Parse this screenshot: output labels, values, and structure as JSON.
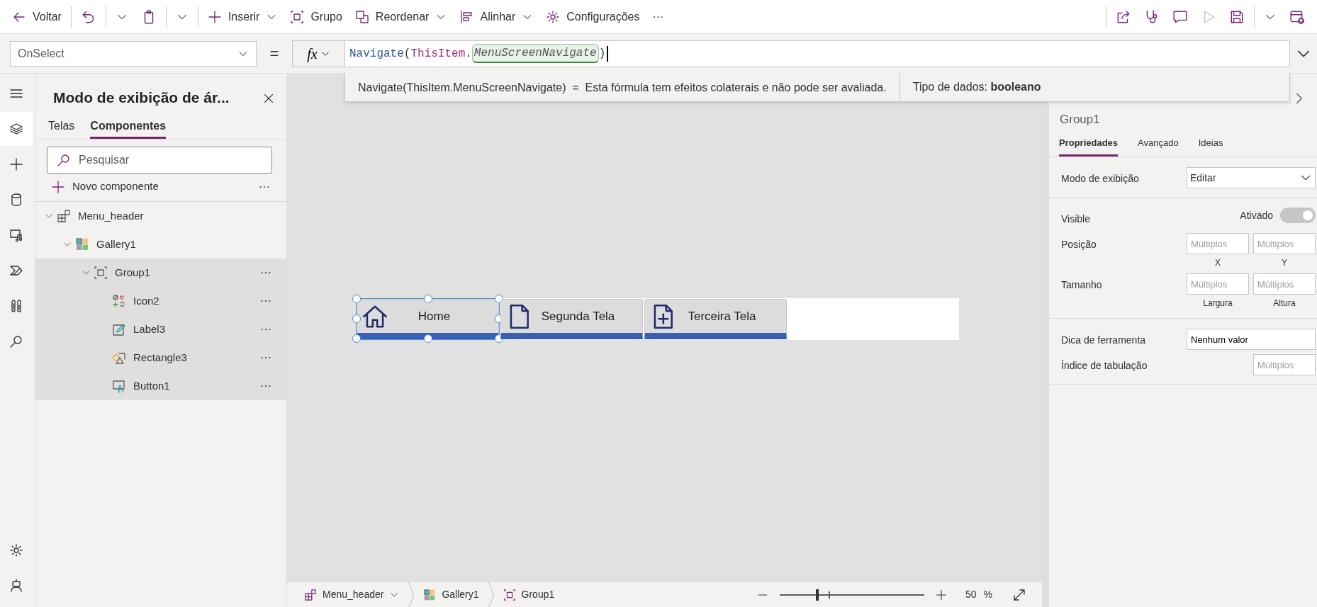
{
  "toolbar": {
    "left": [
      {
        "kind": "button",
        "label": "Voltar",
        "dropdown": false
      },
      {
        "kind": "divider"
      },
      {
        "kind": "split"
      },
      {
        "kind": "split"
      },
      {
        "kind": "divider"
      },
      {
        "kind": "button",
        "label": "Inserir",
        "dropdown": true
      },
      {
        "kind": "button",
        "label": "Grupo",
        "dropdown": false
      },
      {
        "kind": "button",
        "label": "Reordenar",
        "dropdown": true
      },
      {
        "kind": "button",
        "label": "Alinhar",
        "dropdown": true
      },
      {
        "kind": "button",
        "label": "Configurações",
        "dropdown": false
      },
      {
        "kind": "more",
        "label": "···"
      }
    ],
    "right": [
      {
        "kind": "divider"
      },
      {
        "kind": "icon",
        "disabled": false
      },
      {
        "kind": "icon",
        "disabled": false
      },
      {
        "kind": "icon",
        "disabled": false
      },
      {
        "kind": "icon",
        "disabled": true
      },
      {
        "kind": "split",
        "disabled": false
      },
      {
        "kind": "icon",
        "disabled": false
      }
    ]
  },
  "formula_bar": {
    "property": "OnSelect",
    "equals": "=",
    "fx": "fx",
    "tokens": [
      {
        "kind": "function",
        "text": "Navigate"
      },
      {
        "kind": "punct",
        "text": "("
      },
      {
        "kind": "keyword",
        "text": "ThisItem"
      },
      {
        "kind": "punct",
        "text": "."
      },
      {
        "kind": "identifier",
        "text": "MenuScreenNavigate"
      },
      {
        "kind": "punct",
        "text": ")"
      }
    ],
    "help": {
      "expression": "Navigate(ThisItem.MenuScreenNavigate)  =  Esta fórmula tem efeitos colaterais e não pode ser avaliada.",
      "data_type": "Tipo de dados: **booleano**"
    }
  },
  "rail": {
    "top": [
      {
        "selected": false
      },
      {
        "selected": true
      },
      {
        "selected": false
      },
      {
        "selected": false
      },
      {
        "selected": false
      },
      {
        "selected": false
      },
      {
        "selected": false
      },
      {
        "selected": false
      }
    ],
    "bottom": [
      {
        "selected": false
      },
      {
        "selected": false
      }
    ]
  },
  "tree_panel": {
    "title": "Modo de exibição de ár...",
    "tabs": [
      {
        "label": "Telas",
        "selected": false
      },
      {
        "label": "Componentes",
        "selected": true
      }
    ],
    "search": {
      "placeholder": "Pesquisar"
    },
    "new_component": "Novo componente",
    "tree": [
      {
        "kind": "component",
        "label": "Menu_header",
        "expanded": true,
        "selected": false,
        "children": [
          {
            "kind": "gallery",
            "label": "Gallery1",
            "expanded": true,
            "selected": false,
            "children": [
              {
                "kind": "group",
                "label": "Group1",
                "expanded": true,
                "selected": true,
                "children": [
                  {
                    "kind": "icon",
                    "label": "Icon2",
                    "selected": true
                  },
                  {
                    "kind": "label",
                    "label": "Label3",
                    "selected": true
                  },
                  {
                    "kind": "shape",
                    "label": "Rectangle3",
                    "selected": true
                  },
                  {
                    "kind": "button",
                    "label": "Button1",
                    "selected": true
                  }
                ]
              }
            ]
          }
        ]
      }
    ]
  },
  "canvas": {
    "menu": [
      {
        "label": "Home",
        "selected": true
      },
      {
        "label": "Segunda Tela",
        "selected": false
      },
      {
        "label": "Terceira Tela",
        "selected": false
      }
    ]
  },
  "status_bar": {
    "breadcrumbs": [
      {
        "kind": "component",
        "label": "Menu_header",
        "dropdown": true
      },
      {
        "kind": "gallery",
        "label": "Gallery1",
        "dropdown": false
      },
      {
        "kind": "group",
        "label": "Group1",
        "dropdown": false
      }
    ],
    "zoom": {
      "level": 0.25,
      "value": "50",
      "unit": "%"
    }
  },
  "properties": {
    "title": "Group1",
    "tabs": [
      {
        "label": "Propriedades",
        "selected": true
      },
      {
        "label": "Avançado",
        "selected": false
      },
      {
        "label": "Ideias",
        "selected": false
      }
    ],
    "sections": [
      [
        {
          "kind": "dropdown",
          "label": "Modo de exibição",
          "value": "Editar"
        }
      ],
      [
        {
          "kind": "toggle",
          "label": "Visible",
          "state_text": "Ativado",
          "on": true,
          "disabled": true
        },
        {
          "kind": "pair",
          "label": "Posição",
          "fields": [
            {
              "placeholder": "Múltiplos",
              "caption": "X"
            },
            {
              "placeholder": "Múltiplos",
              "caption": "Y"
            }
          ]
        },
        {
          "kind": "pair",
          "label": "Tamanho",
          "fields": [
            {
              "placeholder": "Múltiplos",
              "caption": "Largura"
            },
            {
              "placeholder": "Múltiplos",
              "caption": "Altura"
            }
          ]
        }
      ],
      [
        {
          "kind": "text",
          "label": "Dica de ferramenta",
          "value": "Nenhum valor"
        },
        {
          "kind": "number",
          "label": "Índice de tabulação",
          "placeholder": "Múltiplos"
        }
      ]
    ]
  }
}
